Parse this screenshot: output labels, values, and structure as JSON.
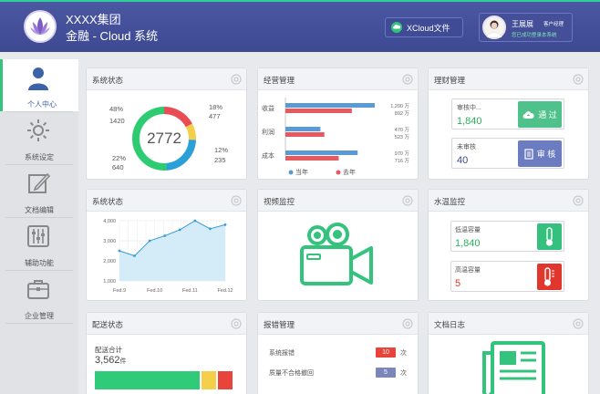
{
  "header": {
    "brand_line1": "XXXX集团",
    "brand_line2": "金融 - Cloud 系统",
    "xcloud_label": "XCloud文件",
    "user_name": "王展展",
    "user_role": "客户经理",
    "user_status": "您已成功登录本系统"
  },
  "sidebar": {
    "items": [
      {
        "label": "个人中心",
        "icon": "user-icon",
        "active": true
      },
      {
        "label": "系统设定",
        "icon": "gear-icon",
        "active": false
      },
      {
        "label": "文档编辑",
        "icon": "edit-icon",
        "active": false
      },
      {
        "label": "辅助功能",
        "icon": "sliders-icon",
        "active": false
      },
      {
        "label": "企业管理",
        "icon": "briefcase-icon",
        "active": false
      }
    ]
  },
  "colors": {
    "accent_green": "#34c37c",
    "header_blue": "#414d96",
    "red": "#e94c55",
    "yellow": "#f3cf4a",
    "blue": "#2b9fd8"
  },
  "cards": {
    "system_status": {
      "title": "系统状态",
      "center_value": "2772",
      "segments": [
        {
          "pct": "18%",
          "value": "477",
          "color": "#e94c55"
        },
        {
          "pct": "12%",
          "value": "235",
          "color": "#f3cf4a"
        },
        {
          "pct": "22%",
          "value": "640",
          "color": "#2b9fd8"
        },
        {
          "pct": "48%",
          "value": "1420",
          "color": "#2ecc71"
        }
      ]
    },
    "business": {
      "title": "经营管理",
      "rows": [
        {
          "label": "收益",
          "current": 1200,
          "previous": 892,
          "current_text": "1,200 万",
          "previous_text": "892 万"
        },
        {
          "label": "利润",
          "current": 470,
          "previous": 523,
          "current_text": "470 万",
          "previous_text": "523 万"
        },
        {
          "label": "成本",
          "current": 970,
          "previous": 716,
          "current_text": "970 万",
          "previous_text": "716 万"
        }
      ],
      "legend_current": "当年",
      "legend_previous": "去年"
    },
    "finance": {
      "title": "理财管理",
      "box1_label": "审核中...",
      "box1_value": "1,840",
      "box1_button": "通 过",
      "box2_label": "未审核",
      "box2_value": "40",
      "box2_button": "审 核"
    },
    "system_trend": {
      "title": "系统状态",
      "y_ticks": [
        "4,000",
        "3,000",
        "2,000",
        "1,000"
      ],
      "x_ticks": [
        "Fed.9",
        "Fed.10",
        "Fed.11",
        "Fed.12"
      ]
    },
    "video": {
      "title": "视频监控"
    },
    "water": {
      "title": "水温监控",
      "low_label": "低温容量",
      "low_value": "1,840",
      "high_label": "高温容量",
      "high_value": "5"
    },
    "delivery": {
      "title": "配送状态",
      "total_label": "配送合计",
      "total_value": "3,562",
      "total_unit": "件"
    },
    "errors": {
      "title": "报错管理",
      "rows": [
        {
          "label": "系统报错",
          "count": "10",
          "unit": "次",
          "color": "#e8443b"
        },
        {
          "label": "质量不合格撤回",
          "count": "5",
          "unit": "次",
          "color": "#7a87b8"
        }
      ]
    },
    "docs": {
      "title": "文档日志"
    }
  },
  "chart_data": [
    {
      "type": "pie",
      "title": "系统状态",
      "categories": [
        "",
        "",
        "",
        ""
      ],
      "values": [
        477,
        235,
        640,
        1420
      ],
      "percentages": [
        18,
        12,
        22,
        48
      ],
      "total": 2772
    },
    {
      "type": "bar",
      "title": "经营管理",
      "categories": [
        "收益",
        "利润",
        "成本"
      ],
      "series": [
        {
          "name": "当年",
          "values": [
            1200,
            470,
            970
          ]
        },
        {
          "name": "去年",
          "values": [
            892,
            523,
            716
          ]
        }
      ]
    },
    {
      "type": "area",
      "title": "系统状态",
      "x_ticks": [
        "Fed.9",
        "Fed.10",
        "Fed.11",
        "Fed.12"
      ],
      "ylim": [
        1000,
        4000
      ],
      "values": [
        2500,
        2250,
        3000,
        3250,
        3550,
        4000,
        3600,
        3800
      ],
      "grid": true
    }
  ]
}
